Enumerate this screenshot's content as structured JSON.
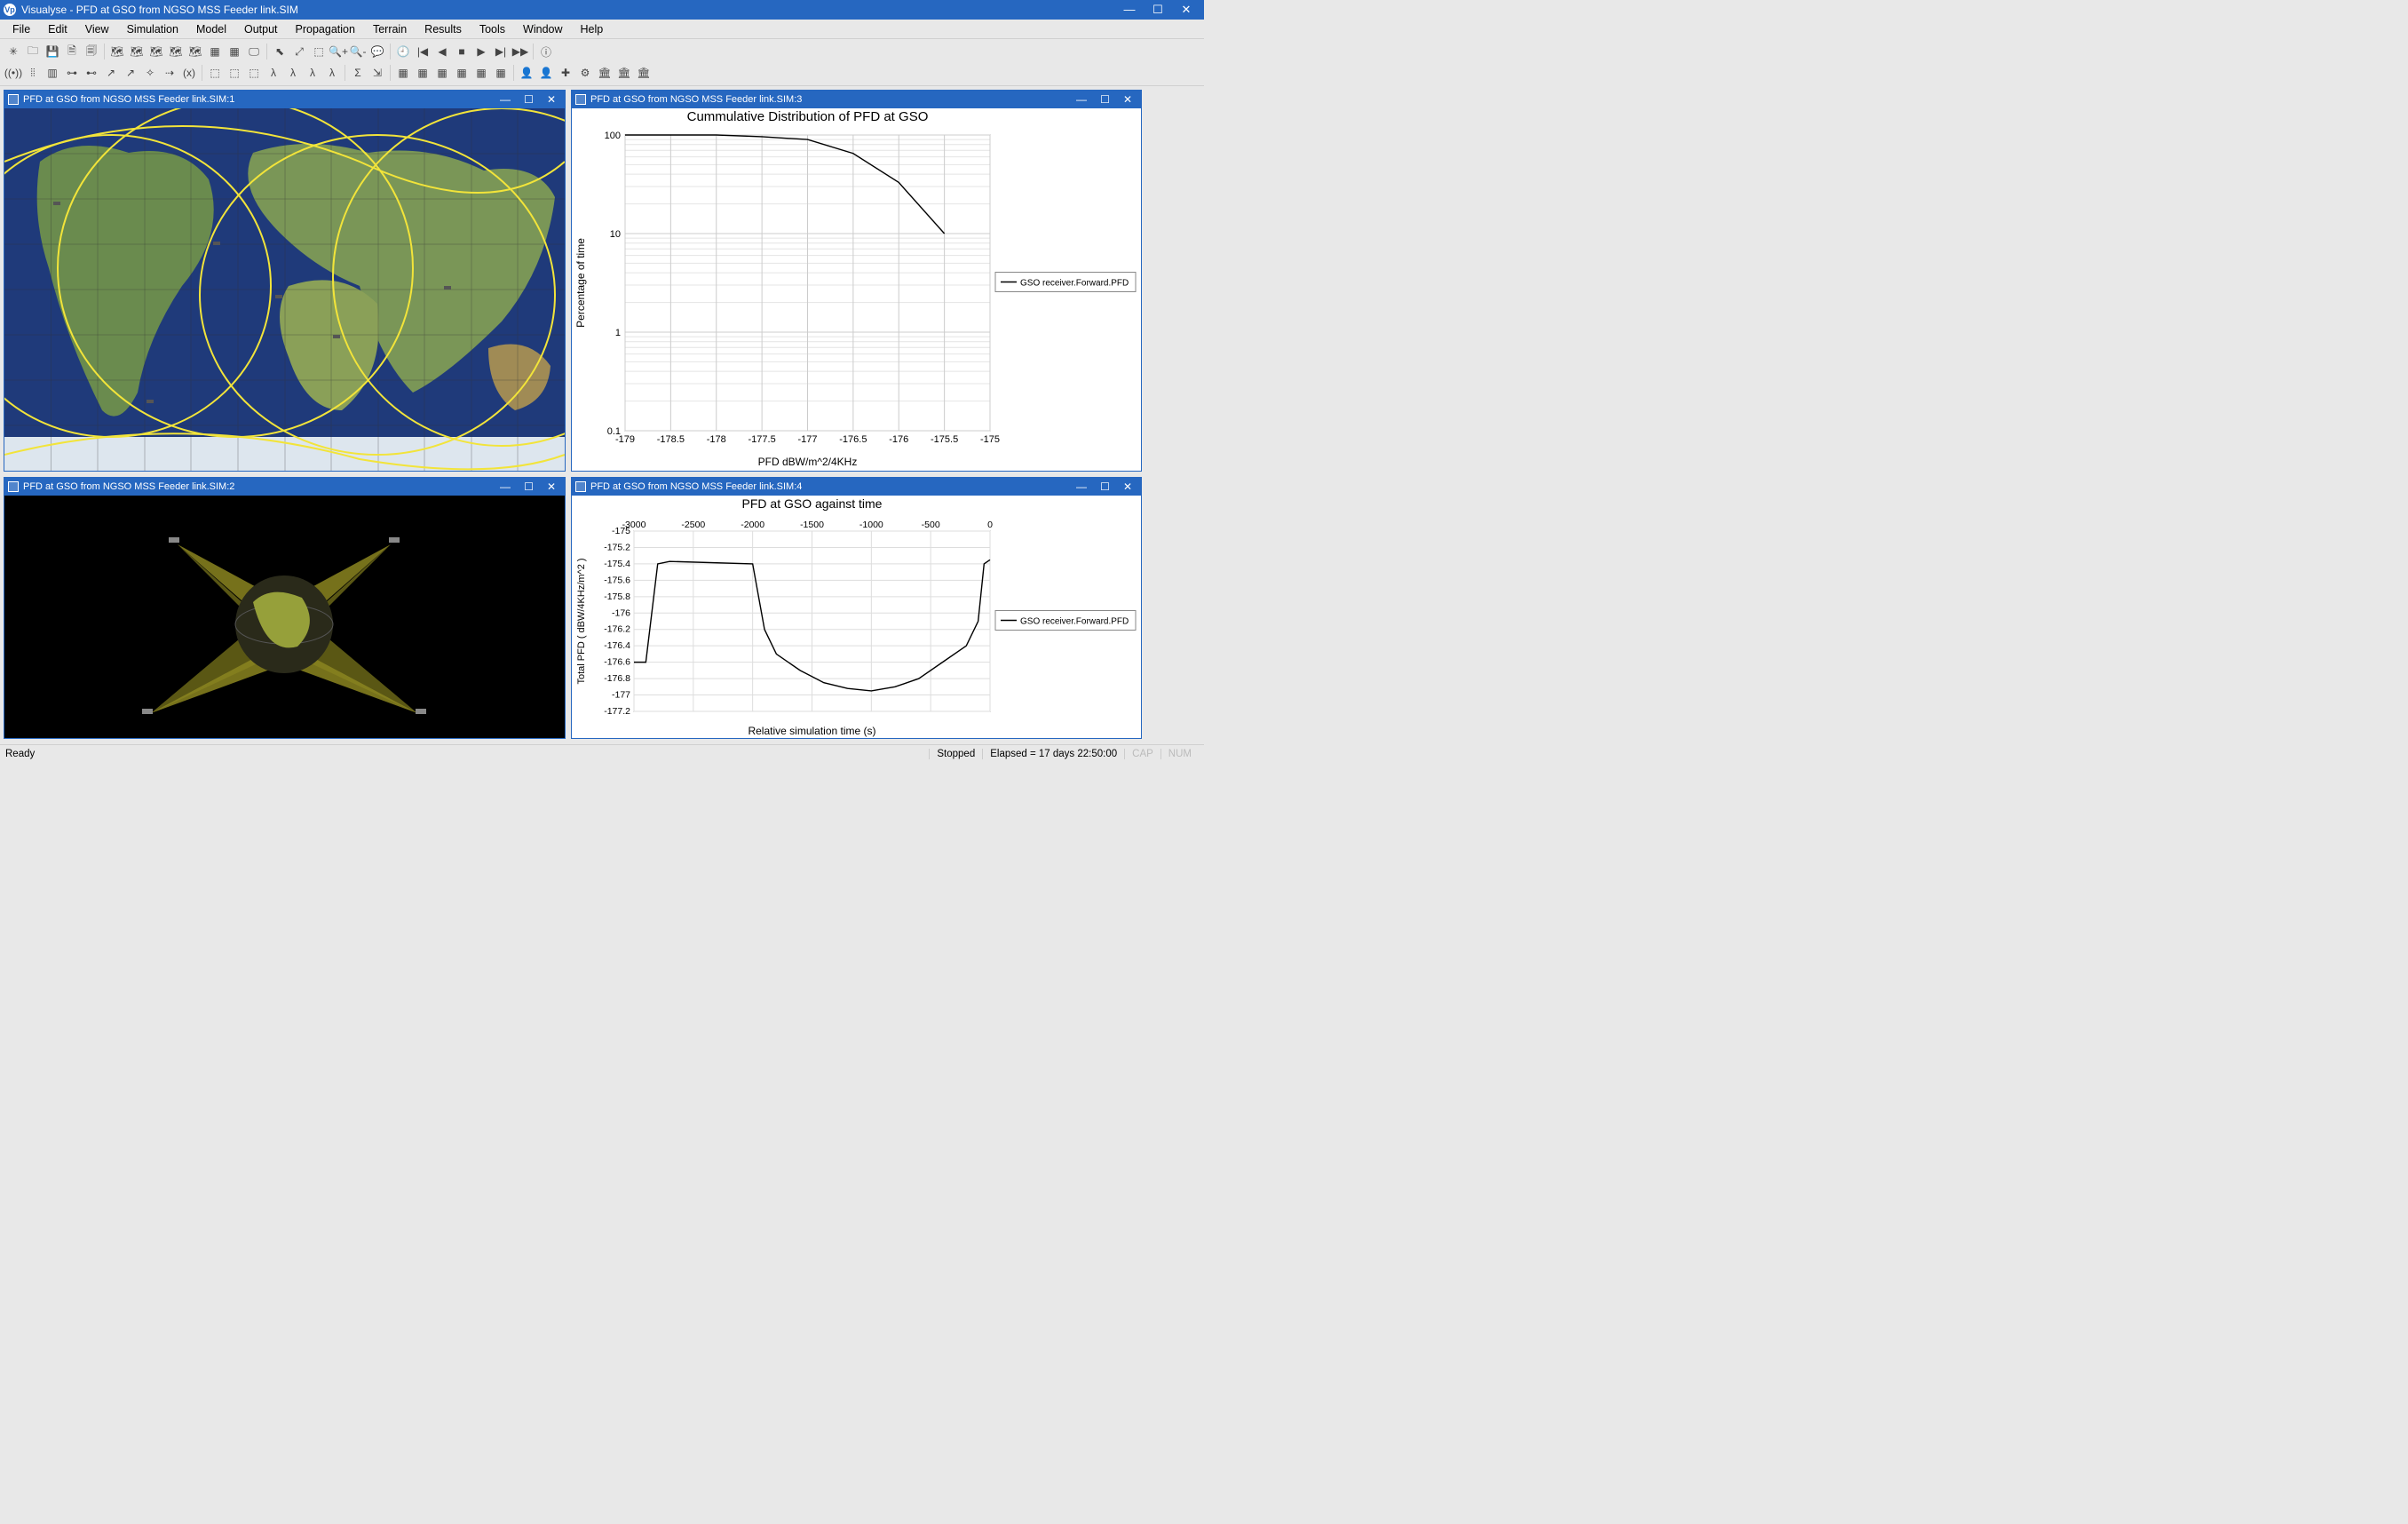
{
  "app": {
    "title": "Visualyse - PFD at GSO from NGSO MSS Feeder link.SIM",
    "icon_label": "Vp"
  },
  "window_controls": {
    "min": "—",
    "max": "☐",
    "close": "✕"
  },
  "menu": [
    "File",
    "Edit",
    "View",
    "Simulation",
    "Model",
    "Output",
    "Propagation",
    "Terrain",
    "Results",
    "Tools",
    "Window",
    "Help"
  ],
  "toolbar_row1_names": [
    "new",
    "open",
    "save",
    "doc1",
    "doc2",
    "|",
    "view-mercator",
    "view-platecaree",
    "view-3d",
    "view-table",
    "view-cursor",
    "view-data",
    "view-chart",
    "view-watch",
    "|",
    "pointer",
    "zoom-area",
    "zoom-window",
    "zoom-in",
    "zoom-out",
    "chat",
    "|",
    "clock",
    "rew-start",
    "rew",
    "stop",
    "play",
    "step",
    "ffwd",
    "|",
    "info"
  ],
  "toolbar_row1_glyphs": [
    "✳",
    "🗀",
    "💾",
    "🗎",
    "🗐",
    "|",
    "🗺",
    "🗺",
    "🗺",
    "🗺",
    "🗺",
    "▦",
    "▦",
    "🖵",
    "|",
    "⬉",
    "⤢",
    "⬚",
    "🔍+",
    "🔍-",
    "💬",
    "|",
    "🕘",
    "|◀",
    "◀",
    "■",
    "▶",
    "▶|",
    "▶▶",
    "|",
    "ⓘ"
  ],
  "toolbar_row2_names": [
    "antenna",
    "grid",
    "beam",
    "link1",
    "link2",
    "arrow",
    "vector",
    "star",
    "route",
    "fx",
    "|",
    "rx1",
    "rx2",
    "rx3",
    "rx4",
    "rx5",
    "rx6",
    "rx7",
    "|",
    "sigma",
    "export",
    "|",
    "tile1",
    "tile2",
    "tile3",
    "tile4",
    "tile5",
    "tile6",
    "|",
    "user1",
    "user2",
    "add",
    "cfg",
    "tb1",
    "tb2",
    "tb3"
  ],
  "toolbar_row2_glyphs": [
    "((•))",
    "⦙⦙",
    "▥",
    "⊶",
    "⊷",
    "↗",
    "↗",
    "✧",
    "⇢",
    "(x)",
    "|",
    "⬚",
    "⬚",
    "⬚",
    "λ",
    "λ",
    "λ",
    "λ",
    "|",
    "Σ",
    "⇲",
    "|",
    "▦",
    "▦",
    "▦",
    "▦",
    "▦",
    "▦",
    "|",
    "👤",
    "👤",
    "✚",
    "⚙",
    "🏛",
    "🏛",
    "🏛"
  ],
  "panes": {
    "p1": "PFD at GSO from NGSO MSS Feeder link.SIM:1",
    "p2": "PFD at GSO from NGSO MSS Feeder link.SIM:2",
    "p3": "PFD at GSO from NGSO MSS Feeder link.SIM:3",
    "p4": "PFD at GSO from NGSO MSS Feeder link.SIM:4"
  },
  "sub_controls": {
    "min": "—",
    "max": "☐",
    "close": "✕"
  },
  "chart_data": [
    {
      "id": "chart3",
      "type": "line",
      "title": "Cummulative Distribution of PFD at GSO",
      "xlabel": "PFD dBW/m^2/4KHz",
      "ylabel": "Percentage of time",
      "yscale": "log",
      "xlim": [
        -179,
        -175
      ],
      "ylim": [
        0.1,
        100
      ],
      "xticks": [
        -179,
        -178.5,
        -178,
        -177.5,
        -177,
        -176.5,
        -176,
        -175.5,
        -175
      ],
      "yticks": [
        0.1,
        1,
        10,
        100
      ],
      "legend": [
        "GSO receiver.Forward.PFD"
      ],
      "series": [
        {
          "name": "GSO receiver.Forward.PFD",
          "x": [
            -179,
            -178.5,
            -178,
            -177.5,
            -177,
            -176.5,
            -176,
            -175.5
          ],
          "y": [
            100,
            100,
            100,
            96,
            90,
            65,
            33,
            10
          ]
        }
      ]
    },
    {
      "id": "chart4",
      "type": "line",
      "title": "PFD at GSO against time",
      "xlabel": "Relative simulation time (s)",
      "ylabel": "Total PFD (  dBW/4KHz/m^2 )",
      "xlim": [
        -3000,
        0
      ],
      "ylim": [
        -177.2,
        -175
      ],
      "xticks": [
        -3000,
        -2500,
        -2000,
        -1500,
        -1000,
        -500,
        0
      ],
      "yticks": [
        -175,
        -175.2,
        -175.4,
        -175.6,
        -175.8,
        -176,
        -176.2,
        -176.4,
        -176.6,
        -176.8,
        -177,
        -177.2
      ],
      "legend": [
        "GSO receiver.Forward.PFD"
      ],
      "series": [
        {
          "name": "GSO receiver.Forward.PFD",
          "x": [
            -3000,
            -2900,
            -2800,
            -2700,
            -2000,
            -1900,
            -1800,
            -1600,
            -1400,
            -1200,
            -1000,
            -800,
            -600,
            -400,
            -200,
            -100,
            -50,
            0
          ],
          "y": [
            -176.6,
            -176.6,
            -175.4,
            -175.37,
            -175.4,
            -176.2,
            -176.5,
            -176.7,
            -176.85,
            -176.92,
            -176.95,
            -176.9,
            -176.8,
            -176.6,
            -176.4,
            -176.1,
            -175.4,
            -175.35
          ]
        }
      ]
    }
  ],
  "status": {
    "left": "Ready",
    "state": "Stopped",
    "elapsed": "Elapsed = 17 days 22:50:00",
    "cap": "CAP",
    "num": "NUM"
  }
}
